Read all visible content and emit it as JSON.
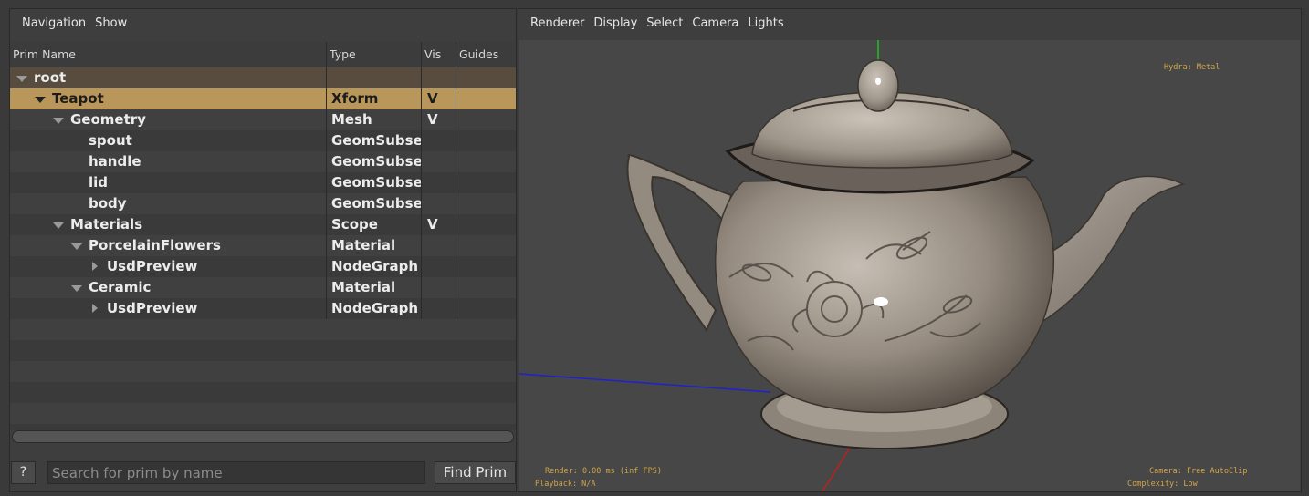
{
  "prim_panel": {
    "menu": [
      "Navigation",
      "Show"
    ],
    "columns": {
      "name": "Prim Name",
      "type": "Type",
      "vis": "Vis",
      "guides": "Guides"
    },
    "rows": [
      {
        "name": "root",
        "type": "",
        "vis": "",
        "depth": 0,
        "expander": "down",
        "state": "root"
      },
      {
        "name": "Teapot",
        "type": "Xform",
        "vis": "V",
        "depth": 1,
        "expander": "down",
        "state": "selected"
      },
      {
        "name": "Geometry",
        "type": "Mesh",
        "vis": "V",
        "depth": 2,
        "expander": "down",
        "state": "normal"
      },
      {
        "name": "spout",
        "type": "GeomSubset",
        "vis": "",
        "depth": 3,
        "expander": "none",
        "state": "normal"
      },
      {
        "name": "handle",
        "type": "GeomSubset",
        "vis": "",
        "depth": 3,
        "expander": "none",
        "state": "normal"
      },
      {
        "name": "lid",
        "type": "GeomSubset",
        "vis": "",
        "depth": 3,
        "expander": "none",
        "state": "normal"
      },
      {
        "name": "body",
        "type": "GeomSubset",
        "vis": "",
        "depth": 3,
        "expander": "none",
        "state": "normal"
      },
      {
        "name": "Materials",
        "type": "Scope",
        "vis": "V",
        "depth": 2,
        "expander": "down",
        "state": "normal"
      },
      {
        "name": "PorcelainFlowers",
        "type": "Material",
        "vis": "",
        "depth": 3,
        "expander": "down",
        "state": "normal"
      },
      {
        "name": "UsdPreview",
        "type": "NodeGraph",
        "vis": "",
        "depth": 4,
        "expander": "right",
        "state": "normal"
      },
      {
        "name": "Ceramic",
        "type": "Material",
        "vis": "",
        "depth": 3,
        "expander": "down",
        "state": "normal"
      },
      {
        "name": "UsdPreview",
        "type": "NodeGraph",
        "vis": "",
        "depth": 4,
        "expander": "right",
        "state": "normal"
      }
    ],
    "help_label": "?",
    "search_placeholder": "Search for prim by name",
    "find_label": "Find Prim"
  },
  "viewer": {
    "menu": [
      "Renderer",
      "Display",
      "Select",
      "Camera",
      "Lights"
    ],
    "hud": {
      "renderer": "Hydra: Metal",
      "render_time": "Render: 0.00 ms (inf FPS)",
      "playback": "Playback: N/A",
      "camera": "Camera: Free AutoClip",
      "complexity": "Complexity: Low"
    }
  },
  "colors": {
    "selected_row": "#b9975b",
    "root_row": "#574c3e",
    "hud_text": "#d0a64a",
    "axis_x": "#c02020",
    "axis_y": "#20c020",
    "axis_z": "#2020d0"
  }
}
